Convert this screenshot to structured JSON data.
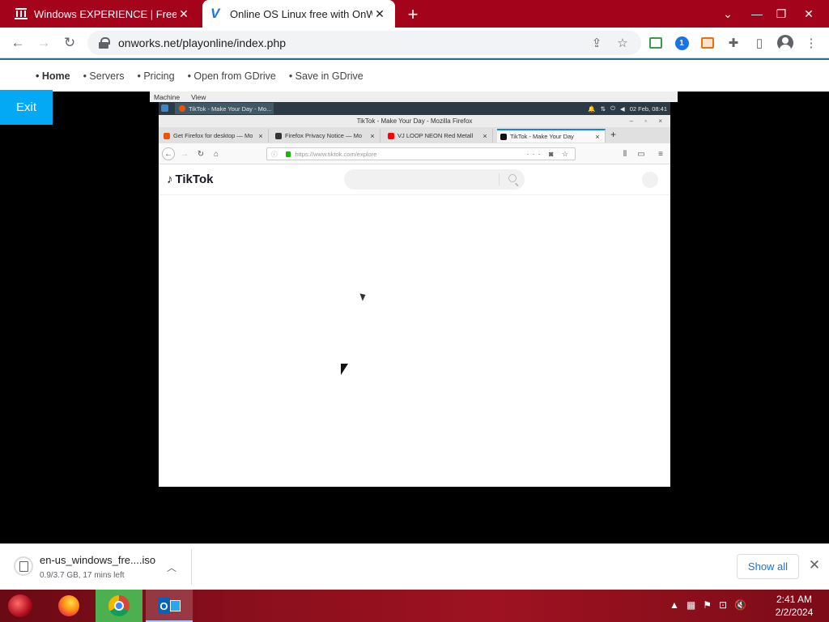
{
  "browser": {
    "tabs": [
      {
        "label": "Windows EXPERIENCE | Freestyle",
        "icon": "museum-icon"
      },
      {
        "label": "Online OS Linux free with OnWorks",
        "icon": "onworks-v-icon",
        "active": true
      }
    ],
    "new_tab": "+",
    "url": "onworks.net/playonline/index.php"
  },
  "site_nav": {
    "items": [
      "• Home",
      "• Servers",
      "• Pricing",
      "• Open from GDrive",
      "• Save in GDrive"
    ],
    "exit_label": "Exit"
  },
  "vm": {
    "menubar": [
      "Machine",
      "View"
    ],
    "panel_task": "TikTok - Make Your Day - Mo...",
    "panel_clock": "02 Feb, 08:41",
    "firefox": {
      "window_title": "TikTok - Make Your Day - Mozilla Firefox",
      "tabs": [
        {
          "label": "Get Firefox for desktop — Mo",
          "color": "#e8540e"
        },
        {
          "label": "Firefox Privacy Notice — Mo",
          "color": "#333333"
        },
        {
          "label": "VJ LOOP NEON Red Metall",
          "color": "#ff0000"
        },
        {
          "label": "TikTok - Make Your Day",
          "color": "#111111",
          "active": true
        }
      ],
      "url": "https://www.tiktok.com/explore"
    },
    "tiktok": {
      "logo_text": "TikTok"
    }
  },
  "downloads": {
    "file_name": "en-us_windows_fre....iso",
    "status": "0.9/3.7 GB, 17 mins left",
    "show_all": "Show all"
  },
  "taskbar": {
    "apps": [
      "firefox-icon",
      "chrome-icon",
      "outlook-icon"
    ],
    "time": "2:41 AM",
    "date": "2/2/2024"
  },
  "colors": {
    "tabstrip": "#a4031c",
    "exit_button": "#03a9f4",
    "accent_blue": "#1a73e8"
  }
}
